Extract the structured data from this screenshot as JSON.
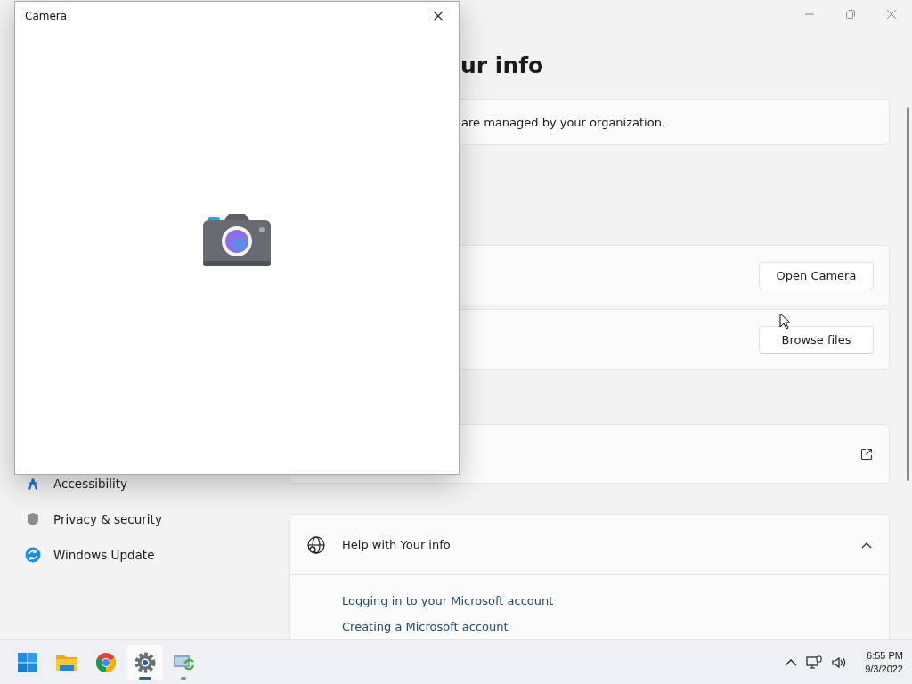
{
  "camera_window": {
    "title": "Camera"
  },
  "settings_window": {
    "heading": "ur info",
    "notice": "are managed by your organization.",
    "photo_cards": [
      {
        "button": "Open Camera"
      },
      {
        "button": "Browse files"
      }
    ],
    "sidebar": {
      "items": [
        {
          "kind": "accessibility",
          "label": "Accessibility"
        },
        {
          "kind": "privacy",
          "label": "Privacy & security"
        },
        {
          "kind": "update",
          "label": "Windows Update"
        }
      ]
    },
    "help": {
      "title": "Help with Your info",
      "expanded": true,
      "links": [
        "Logging in to your Microsoft account",
        "Creating a Microsoft account"
      ]
    }
  },
  "taskbar": {
    "apps": [
      {
        "kind": "start",
        "selected": false,
        "running": false
      },
      {
        "kind": "explorer",
        "selected": false,
        "running": false
      },
      {
        "kind": "chrome",
        "selected": false,
        "running": false
      },
      {
        "kind": "settings",
        "selected": true,
        "running": true
      },
      {
        "kind": "sync",
        "selected": false,
        "running": true
      }
    ],
    "clock": {
      "time": "6:55 PM",
      "date": "9/3/2022"
    }
  }
}
